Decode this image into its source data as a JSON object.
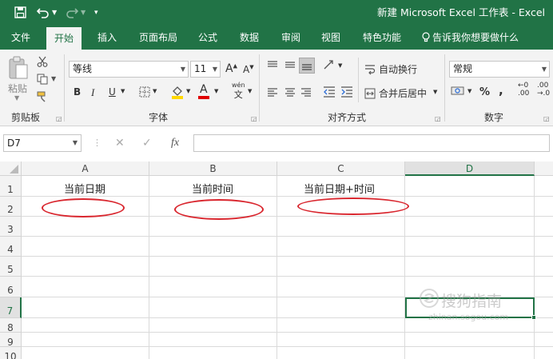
{
  "titlebar": {
    "save_icon": "save-icon",
    "undo_icon": "undo-icon",
    "redo_icon": "redo-icon",
    "customize_icon": "customize-quick-access-icon",
    "title": "新建 Microsoft Excel 工作表  -  Excel"
  },
  "tabs": [
    "文件",
    "开始",
    "插入",
    "页面布局",
    "公式",
    "数据",
    "审阅",
    "视图",
    "特色功能"
  ],
  "active_tab": "开始",
  "tell_me": "告诉我你想要做什么",
  "ribbon": {
    "clipboard": {
      "paste": "粘贴",
      "group_label": "剪贴板"
    },
    "font": {
      "font_name": "等线",
      "font_size": "11",
      "grow": "A",
      "shrink": "A",
      "bold": "B",
      "italic": "I",
      "underline": "U",
      "font_color_letter": "A",
      "phonetic_top": "wén",
      "phonetic_bottom": "文",
      "group_label": "字体"
    },
    "alignment": {
      "wrap_text": "自动换行",
      "merge_center": "合并后居中",
      "group_label": "对齐方式"
    },
    "number": {
      "format": "常规",
      "percent": "%",
      "comma": ",",
      "inc_decimal": ".00",
      "dec_decimal": ".00",
      "group_label": "数字"
    },
    "colors": {
      "accent": "#217346",
      "fill": "#ffd800",
      "font_red": "#e00000"
    }
  },
  "formula_bar": {
    "name_box": "D7",
    "cancel": "✕",
    "enter": "✓",
    "fx": "fx",
    "value": ""
  },
  "sheet": {
    "columns": [
      "A",
      "B",
      "C",
      "D"
    ],
    "selected_column": "D",
    "rows": [
      "1",
      "2",
      "3",
      "4",
      "5",
      "6",
      "7",
      "8",
      "9",
      "10"
    ],
    "selected_row": "7",
    "cells": {
      "A1": "当前日期",
      "B1": "当前时间",
      "C1": "当前日期+时间"
    },
    "active_cell": "D7",
    "annotation_color": "#d9262e"
  },
  "watermark": {
    "brand": "搜狗指南",
    "url": "zhinan.sogou.com"
  }
}
